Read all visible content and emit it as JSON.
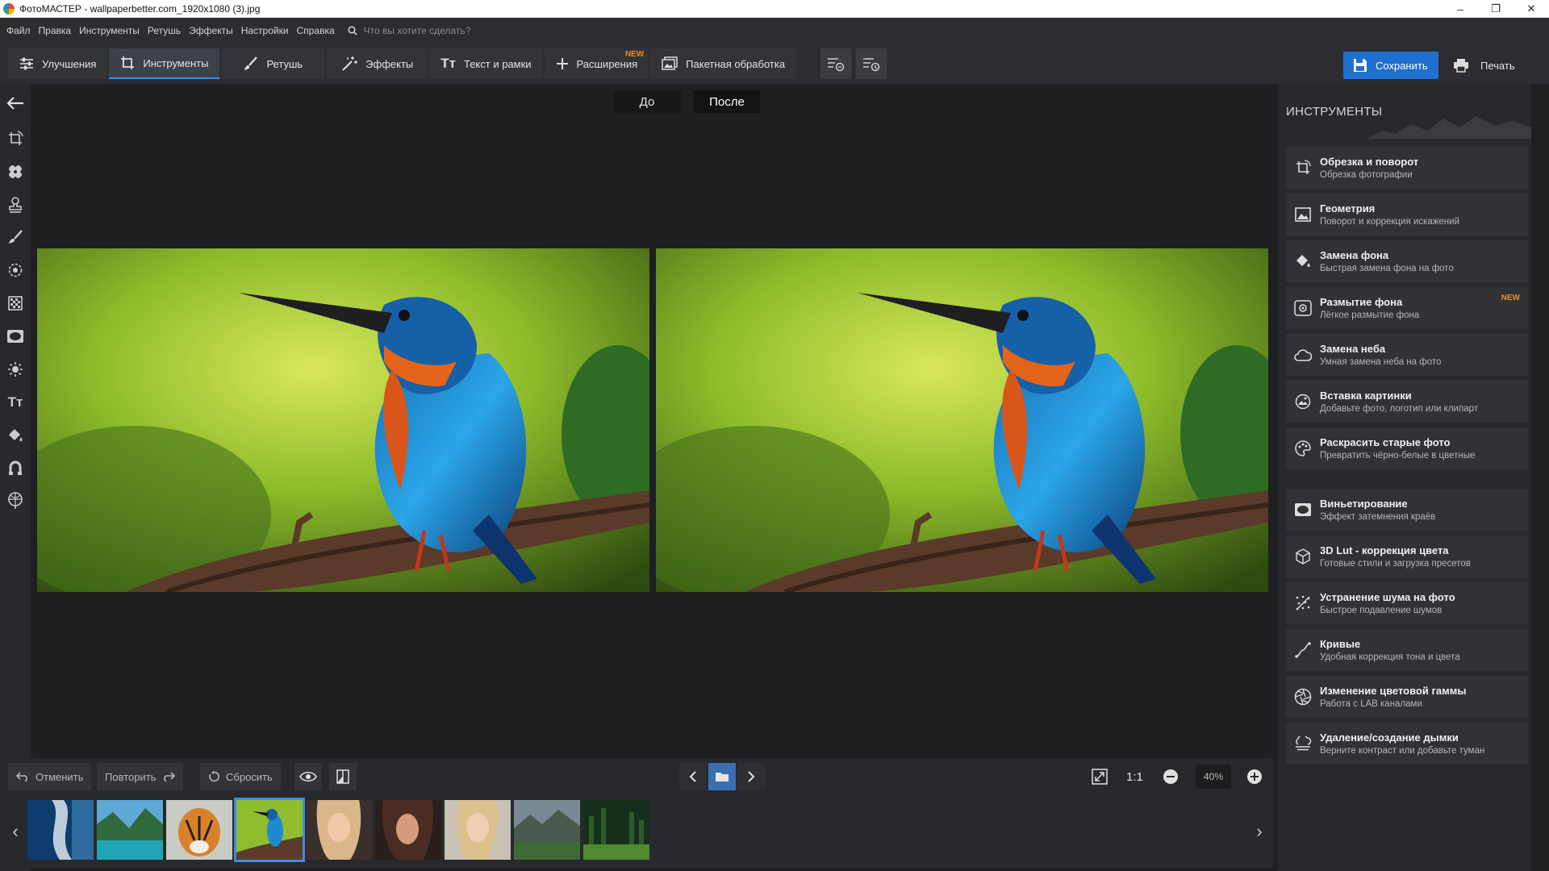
{
  "window": {
    "title": "ФотоМАСТЕР - wallpaperbetter.com_1920x1080 (3).jpg",
    "controls": [
      "–",
      "❐",
      "✕"
    ]
  },
  "menu": {
    "items": [
      "Файл",
      "Правка",
      "Инструменты",
      "Ретушь",
      "Эффекты",
      "Настройки",
      "Справка"
    ],
    "search_placeholder": "Что вы хотите сделать?"
  },
  "toolbar": {
    "tabs": [
      {
        "label": "Улучшения",
        "icon": "sliders-icon"
      },
      {
        "label": "Инструменты",
        "icon": "crop-icon",
        "active": true
      },
      {
        "label": "Ретушь",
        "icon": "brush-icon"
      },
      {
        "label": "Эффекты",
        "icon": "magic-wand-icon"
      },
      {
        "label": "Текст и рамки",
        "icon": "text-icon"
      },
      {
        "label": "Расширения",
        "icon": "plus-icon",
        "badge": "NEW"
      },
      {
        "label": "Пакетная обработка",
        "icon": "batch-image-icon"
      }
    ],
    "save_label": "Сохранить",
    "print_label": "Печать"
  },
  "compare": {
    "before_label": "До",
    "after_label": "После"
  },
  "bottom": {
    "undo_label": "Отменить",
    "redo_label": "Повторить",
    "reset_label": "Сбросить",
    "zoom_one_to_one": "1:1",
    "zoom_value": "40%"
  },
  "panel": {
    "title": "ИНСТРУМЕНТЫ",
    "tools": [
      {
        "title": "Обрезка и поворот",
        "subtitle": "Обрезка фотографии",
        "icon": "crop-rotate-icon"
      },
      {
        "title": "Геометрия",
        "subtitle": "Поворот и коррекция искажений",
        "icon": "geometry-icon"
      },
      {
        "title": "Замена фона",
        "subtitle": "Быстрая замена фона на фото",
        "icon": "paint-bucket-icon"
      },
      {
        "title": "Размытие фона",
        "subtitle": "Лёгкое размытие фона",
        "icon": "blur-bg-icon",
        "badge": "NEW"
      },
      {
        "title": "Замена неба",
        "subtitle": "Умная замена неба на фото",
        "icon": "cloud-icon"
      },
      {
        "title": "Вставка картинки",
        "subtitle": "Добавьте фото, логотип или клипарт",
        "icon": "insert-image-icon"
      },
      {
        "title": "Раскрасить старые фото",
        "subtitle": "Превратить чёрно-белые в цветные",
        "icon": "palette-icon"
      },
      {
        "title": "Виньетирование",
        "subtitle": "Эффект затемнения краёв",
        "icon": "vignette-icon"
      },
      {
        "title": "3D Lut - коррекция цвета",
        "subtitle": "Готовые стили и загрузка пресетов",
        "icon": "lut-cube-icon"
      },
      {
        "title": "Устранение шума на фото",
        "subtitle": "Быстрое подавление шумов",
        "icon": "noise-icon"
      },
      {
        "title": "Кривые",
        "subtitle": "Удобная коррекция тона и цвета",
        "icon": "curves-icon"
      },
      {
        "title": "Изменение цветовой гаммы",
        "subtitle": "Работа с LAB каналами",
        "icon": "aperture-icon"
      },
      {
        "title": "Удаление/создание дымки",
        "subtitle": "Верните контраст или добавьте туман",
        "icon": "haze-icon"
      }
    ]
  },
  "accent_color": "#1f6fd1",
  "badge_color": "#f08a24"
}
